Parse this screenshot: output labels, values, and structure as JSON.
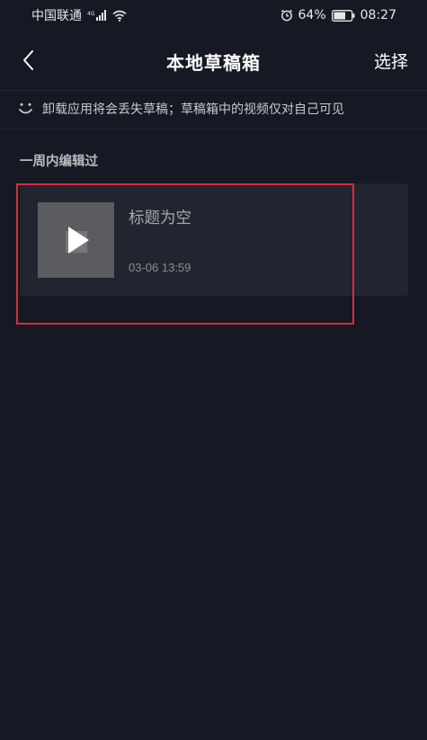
{
  "status_bar": {
    "carrier": "中国联通",
    "battery": "64%",
    "time": "08:27"
  },
  "nav": {
    "title": "本地草稿箱",
    "select_label": "选择"
  },
  "notice": {
    "text": "卸载应用将会丢失草稿；草稿箱中的视频仅对自己可见"
  },
  "section": {
    "title": "一周内编辑过"
  },
  "drafts": [
    {
      "title": "标题为空",
      "time": "03-06 13:59"
    }
  ],
  "icons": {
    "back": "chevron-left-icon",
    "signal": "signal-icon",
    "wifi": "wifi-icon",
    "alarm": "alarm-icon",
    "battery": "battery-icon",
    "notice": "smile-icon",
    "play": "play-icon"
  },
  "colors": {
    "background": "#161823",
    "card": "#222430",
    "highlight": "#d82d3a"
  }
}
